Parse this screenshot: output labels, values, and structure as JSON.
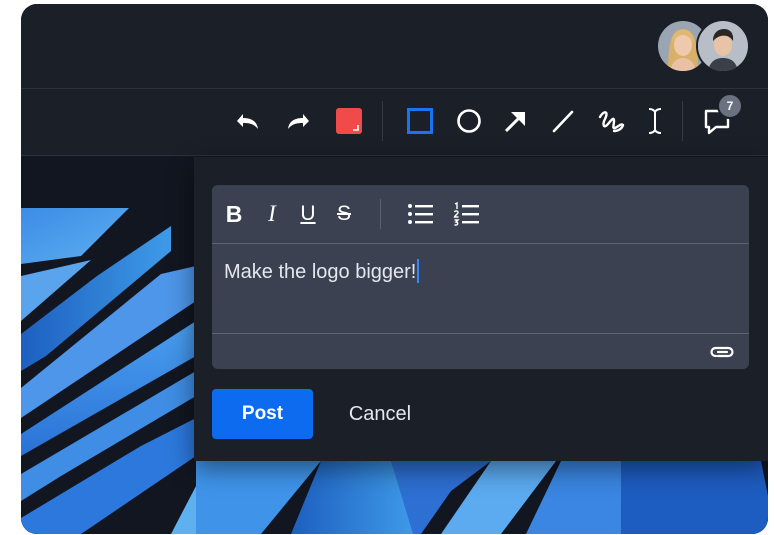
{
  "header": {
    "avatars": [
      {
        "icon": "avatar-woman-blonde"
      },
      {
        "icon": "avatar-man-dark-hair"
      }
    ]
  },
  "toolbar": {
    "tools": [
      {
        "icon": "undo-icon"
      },
      {
        "icon": "redo-icon"
      },
      {
        "icon": "color-swatch-icon",
        "color": "#f04a4a"
      },
      {
        "icon": "rectangle-icon",
        "selected": true,
        "color": "#1a73f0"
      },
      {
        "icon": "circle-icon"
      },
      {
        "icon": "arrow-icon"
      },
      {
        "icon": "line-icon"
      },
      {
        "icon": "freehand-icon"
      },
      {
        "icon": "text-cursor-icon"
      },
      {
        "icon": "comments-icon"
      }
    ],
    "comments_count": "7"
  },
  "comment_editor": {
    "format_buttons": [
      "bold-icon",
      "italic-icon",
      "underline-icon",
      "strikethrough-icon",
      "bullet-list-icon",
      "numbered-list-icon"
    ],
    "bold_label": "B",
    "italic_label": "I",
    "underline_label": "U",
    "strike_label": "S",
    "text": "Make the logo bigger!",
    "attach_icon": "paperclip-icon"
  },
  "actions": {
    "post_label": "Post",
    "cancel_label": "Cancel"
  },
  "colors": {
    "accent": "#0d6bf0",
    "background": "#1b1f28",
    "editor": "#3b4151",
    "swatch": "#f04a4a"
  }
}
